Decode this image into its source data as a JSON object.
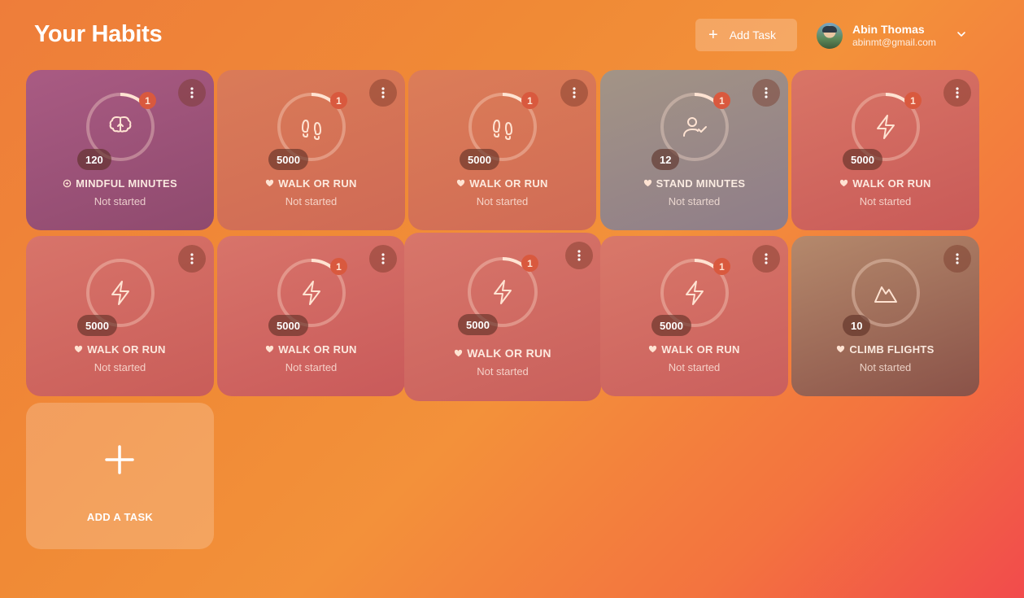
{
  "header": {
    "title": "Your Habits",
    "add_task_label": "Add Task",
    "user": {
      "name": "Abin Thomas",
      "email": "abinmt@gmail.com"
    }
  },
  "habits": [
    {
      "name": "MINDFUL MINUTES",
      "goal": "120",
      "status": "Not started",
      "badge": "1",
      "icon": "brain-icon",
      "category_icon": "mindfulness-icon",
      "color": "#a95b83"
    },
    {
      "name": "WALK OR RUN",
      "goal": "5000",
      "status": "Not started",
      "badge": "1",
      "icon": "footprints-icon",
      "category_icon": "heart-icon",
      "color": "#da7b58"
    },
    {
      "name": "WALK OR RUN",
      "goal": "5000",
      "status": "Not started",
      "badge": "1",
      "icon": "footprints-icon",
      "category_icon": "heart-icon",
      "color": "#dc7d58"
    },
    {
      "name": "STAND MINUTES",
      "goal": "12",
      "status": "Not started",
      "badge": "1",
      "icon": "user-check-icon",
      "category_icon": "heart-icon",
      "color": "#9b8a86"
    },
    {
      "name": "WALK OR RUN",
      "goal": "5000",
      "status": "Not started",
      "badge": "1",
      "icon": "lightning-icon",
      "category_icon": "heart-icon",
      "color": "#d97566"
    },
    {
      "name": "WALK OR RUN",
      "goal": "5000",
      "status": "Not started",
      "badge": "",
      "icon": "lightning-icon",
      "category_icon": "heart-icon",
      "color": "#d8746a"
    },
    {
      "name": "WALK OR RUN",
      "goal": "5000",
      "status": "Not started",
      "badge": "1",
      "icon": "lightning-icon",
      "category_icon": "heart-icon",
      "color": "#d8746a"
    },
    {
      "name": "WALK OR RUN",
      "goal": "5000",
      "status": "Not started",
      "badge": "1",
      "icon": "lightning-icon",
      "category_icon": "heart-icon",
      "color": "#d8766a"
    },
    {
      "name": "WALK OR RUN",
      "goal": "5000",
      "status": "Not started",
      "badge": "1",
      "icon": "lightning-icon",
      "category_icon": "heart-icon",
      "color": "#d97869"
    },
    {
      "name": "CLIMB FLIGHTS",
      "goal": "10",
      "status": "Not started",
      "badge": "",
      "icon": "mountain-icon",
      "category_icon": "heart-icon",
      "color": "#b07a66"
    }
  ],
  "add_card": {
    "label": "ADD A TASK"
  }
}
